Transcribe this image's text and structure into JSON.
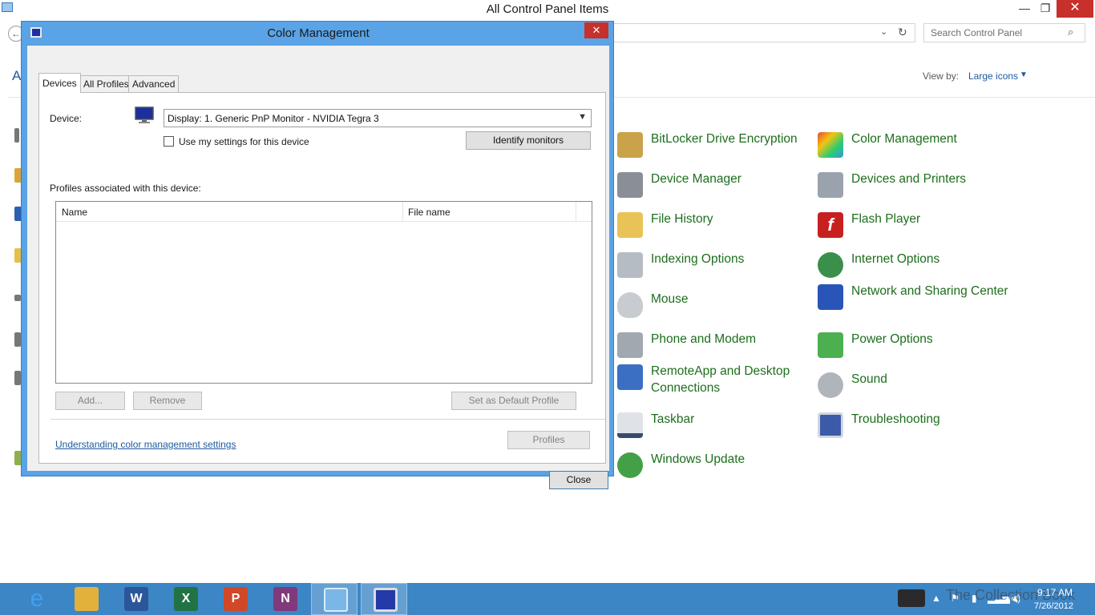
{
  "control_panel": {
    "title": "All Control Panel Items",
    "search_placeholder": "Search Control Panel",
    "header_stub": "A",
    "view_by_label": "View by:",
    "view_by_value": "Large icons",
    "items": [
      {
        "label": "BitLocker Drive Encryption",
        "icon": "bitlocker-icon"
      },
      {
        "label": "Color Management",
        "icon": "color-management-icon"
      },
      {
        "label": "Device Manager",
        "icon": "device-manager-icon"
      },
      {
        "label": "Devices and Printers",
        "icon": "devices-printers-icon"
      },
      {
        "label": "File History",
        "icon": "file-history-icon"
      },
      {
        "label": "Flash Player",
        "icon": "flash-player-icon"
      },
      {
        "label": "Indexing Options",
        "icon": "indexing-icon"
      },
      {
        "label": "Internet Options",
        "icon": "internet-options-icon"
      },
      {
        "label": "Mouse",
        "icon": "mouse-icon"
      },
      {
        "label": "Network and Sharing Center",
        "icon": "network-icon"
      },
      {
        "label": "Phone and Modem",
        "icon": "phone-modem-icon"
      },
      {
        "label": "Power Options",
        "icon": "power-options-icon"
      },
      {
        "label": "RemoteApp and Desktop Connections",
        "icon": "remoteapp-icon"
      },
      {
        "label": "Sound",
        "icon": "sound-icon"
      },
      {
        "label": "Taskbar",
        "icon": "taskbar-icon"
      },
      {
        "label": "Troubleshooting",
        "icon": "troubleshooting-icon"
      },
      {
        "label": "Windows Update",
        "icon": "windows-update-icon"
      }
    ]
  },
  "dialog": {
    "title": "Color Management",
    "close_glyph": "✕",
    "tabs": [
      "Devices",
      "All Profiles",
      "Advanced"
    ],
    "device_label": "Device:",
    "device_value": "Display: 1. Generic PnP Monitor - NVIDIA Tegra 3",
    "use_my_settings": "Use my settings for this device",
    "identify_button": "Identify monitors",
    "profiles_label": "Profiles associated with this device:",
    "columns": [
      "Name",
      "File name"
    ],
    "add_button": "Add...",
    "remove_button": "Remove",
    "default_button": "Set as Default Profile",
    "understanding_link": "Understanding color management settings",
    "profiles_button": "Profiles",
    "close_button": "Close"
  },
  "taskbar": {
    "apps": [
      {
        "name": "internet-explorer",
        "glyph": "e",
        "color": "#1f73c7"
      },
      {
        "name": "file-explorer",
        "glyph": "",
        "color": "#e2b13b"
      },
      {
        "name": "word",
        "glyph": "W",
        "color": "#2b579a"
      },
      {
        "name": "excel",
        "glyph": "X",
        "color": "#217346"
      },
      {
        "name": "powerpoint",
        "glyph": "P",
        "color": "#d24726"
      },
      {
        "name": "onenote",
        "glyph": "N",
        "color": "#80397b"
      },
      {
        "name": "control-panel",
        "glyph": "",
        "color": "#7ab6e8"
      },
      {
        "name": "color-management",
        "glyph": "",
        "color": "#233aa8"
      }
    ],
    "time": "9:17 AM",
    "date": "7/26/2012",
    "watermark": "The Collection Book"
  },
  "colors": {
    "dialog_frame": "#5aa3e6",
    "taskbar": "#3c86c6",
    "link": "#1e5aa0",
    "item_text": "#1d6e1d",
    "close_red": "#c7302b"
  }
}
